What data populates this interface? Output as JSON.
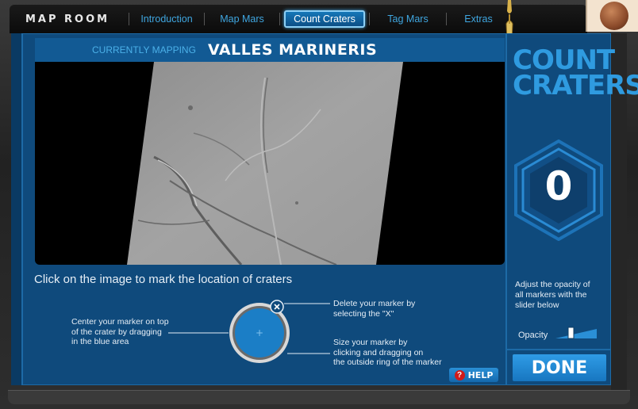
{
  "nav": {
    "brand": "MAP ROOM",
    "items": [
      {
        "label": "Introduction",
        "active": false
      },
      {
        "label": "Map Mars",
        "active": false
      },
      {
        "label": "Count Craters",
        "active": true
      },
      {
        "label": "Tag Mars",
        "active": false
      },
      {
        "label": "Extras",
        "active": false
      }
    ]
  },
  "header": {
    "currently_mapping_label": "CURRENTLY MAPPING",
    "region_name": "VALLES MARINERIS"
  },
  "instructions": {
    "main": "Click on the image to mark the location of craters",
    "center_marker": [
      "Center your marker on top",
      "of the crater by dragging",
      "in the blue area"
    ],
    "delete_marker": [
      "Delete your marker by",
      "selecting the \"X\""
    ],
    "size_marker": [
      "Size your marker by",
      "clicking and dragging on",
      "the outside ring of the marker"
    ]
  },
  "help": {
    "label": "HELP",
    "icon": "question-icon"
  },
  "side": {
    "title_line1": "COUNT",
    "title_line2": "CRATERS",
    "crater_count": "0",
    "opacity_description": [
      "Adjust the opacity of",
      "all markers with the",
      "slider below"
    ],
    "opacity_label": "Opacity",
    "done_label": "DONE"
  },
  "colors": {
    "accent": "#2f9be0",
    "panel": "#0f4a7c",
    "help_icon": "#d01a1a"
  }
}
